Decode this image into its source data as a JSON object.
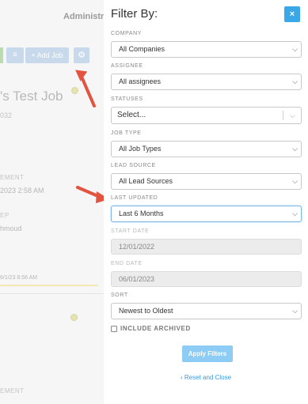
{
  "background": {
    "admin_text": "Administrat",
    "add_job_label": "+ Add Job",
    "job_title": "'s Test Job",
    "job_number": "032",
    "label1": "EMENT",
    "value1": "2023 2:58 AM",
    "label2": "EP",
    "value2": "hmoud",
    "timestamp": "6/1/23 8:56 AM",
    "label3": "EMENT"
  },
  "panel": {
    "title": "Filter By:",
    "close_label": "×",
    "company": {
      "label": "COMPANY",
      "value": "All Companies"
    },
    "assignee": {
      "label": "ASSIGNEE",
      "value": "All assignees"
    },
    "statuses": {
      "label": "STATUSES",
      "placeholder": "Select..."
    },
    "job_type": {
      "label": "JOB TYPE",
      "value": "All Job Types"
    },
    "lead_source": {
      "label": "LEAD SOURCE",
      "value": "All Lead Sources"
    },
    "last_updated": {
      "label": "LAST UPDATED",
      "value": "Last 6 Months"
    },
    "start_date": {
      "label": "START DATE",
      "value": "12/01/2022"
    },
    "end_date": {
      "label": "END DATE",
      "value": "06/01/2023"
    },
    "sort": {
      "label": "SORT",
      "value": "Newest to Oldest"
    },
    "include_archived": {
      "label": "INCLUDE ARCHIVED",
      "checked": false
    },
    "apply_label": "Apply Filters",
    "reset_label": "‹  Reset and Close"
  },
  "colors": {
    "accent": "#3aa7e6",
    "apply_button": "#8dcdf5",
    "arrow": "#e2543f"
  },
  "icons": {
    "select_chevron": "chevron-down-icon",
    "close": "close-icon",
    "annotation": "red-arrow"
  }
}
